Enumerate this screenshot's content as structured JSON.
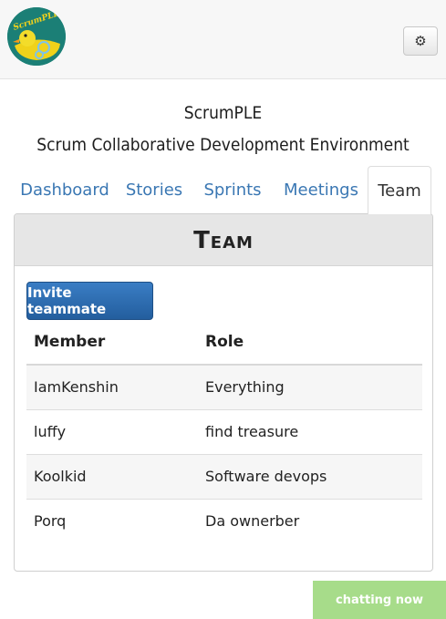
{
  "header": {
    "logo_text": "ScrumPLE",
    "settings_icon": "gear-icon"
  },
  "titles": {
    "app_name": "ScrumPLE",
    "subtitle": "Scrum Collaborative Development Environment"
  },
  "tabs": [
    {
      "label": "Dashboard",
      "active": false
    },
    {
      "label": "Stories",
      "active": false
    },
    {
      "label": "Sprints",
      "active": false
    },
    {
      "label": "Meetings",
      "active": false
    },
    {
      "label": "Team",
      "active": true
    }
  ],
  "panel": {
    "heading": "Team",
    "invite_label": "Invite teammate",
    "columns": [
      "Member",
      "Role"
    ],
    "rows": [
      {
        "member": "IamKenshin",
        "role": "Everything"
      },
      {
        "member": "luffy",
        "role": "find treasure"
      },
      {
        "member": "Koolkid",
        "role": "Software devops"
      },
      {
        "member": "Porq",
        "role": "Da ownerber"
      }
    ]
  },
  "chat": {
    "label": "chatting now"
  },
  "colors": {
    "link": "#3a77b3",
    "primary_button": "#2a69ad",
    "chat_button": "#a7dc8a"
  }
}
